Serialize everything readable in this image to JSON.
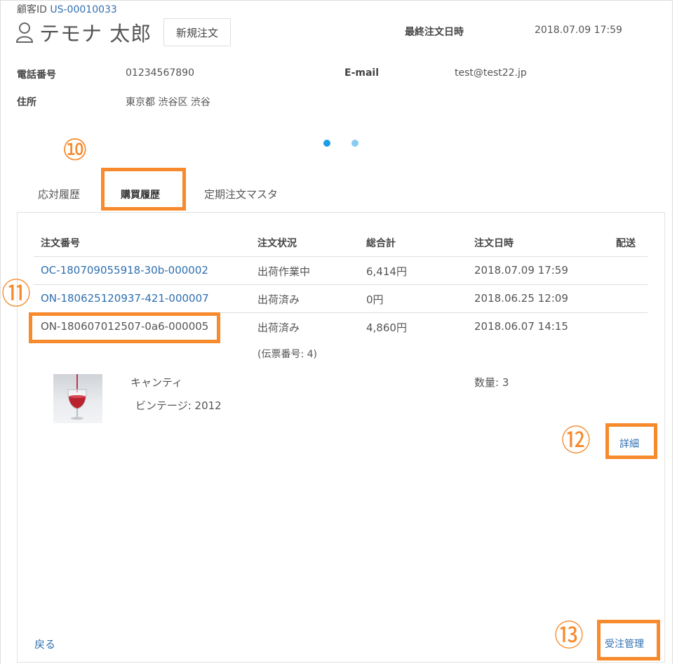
{
  "customer": {
    "id_label": "顧客ID",
    "id_value": "US-00010033",
    "name": "テモナ 太郎",
    "new_order_button": "新規注文",
    "last_order_label": "最終注文日時",
    "last_order_value": "2018.07.09 17:59",
    "phone_label": "電話番号",
    "phone_value": "01234567890",
    "email_label": "E-mail",
    "email_value": "test@test22.jp",
    "address_label": "住所",
    "address_value": "東京都 渋谷区 渋谷"
  },
  "tabs": [
    {
      "label": "応対履歴",
      "active": false
    },
    {
      "label": "購買履歴",
      "active": true
    },
    {
      "label": "定期注文マスタ",
      "active": false
    }
  ],
  "table": {
    "headers": [
      "注文番号",
      "注文状況",
      "総合計",
      "注文日時",
      "配送"
    ],
    "rows": [
      {
        "order_no": "OC-180709055918-30b-000002",
        "status": "出荷作業中",
        "total": "6,414円",
        "date": "2018.07.09 17:59",
        "link": true
      },
      {
        "order_no": "ON-180625120937-421-000007",
        "status": "出荷済み",
        "total": "0円",
        "date": "2018.06.25 12:09",
        "link": true
      },
      {
        "order_no": "ON-180607012507-0a6-000005",
        "status": "出荷済み",
        "total": "4,860円",
        "date": "2018.06.07 14:15",
        "link": false
      }
    ],
    "slip_note": "(伝票番号: 4)"
  },
  "product": {
    "name": "キャンティ",
    "vintage": "ビンテージ: 2012",
    "quantity": "数量: 3"
  },
  "links": {
    "detail": "詳細",
    "back": "戻る",
    "order_management": "受注管理"
  },
  "markers": {
    "m10": "⑩",
    "m11": "⑪",
    "m12": "⑫",
    "m13": "⑬"
  },
  "colors": {
    "accent_orange": "#f68a2c",
    "link_blue": "#2f6fb0",
    "dot_active": "#1a9ee6",
    "dot_inactive": "#86cdf1"
  }
}
